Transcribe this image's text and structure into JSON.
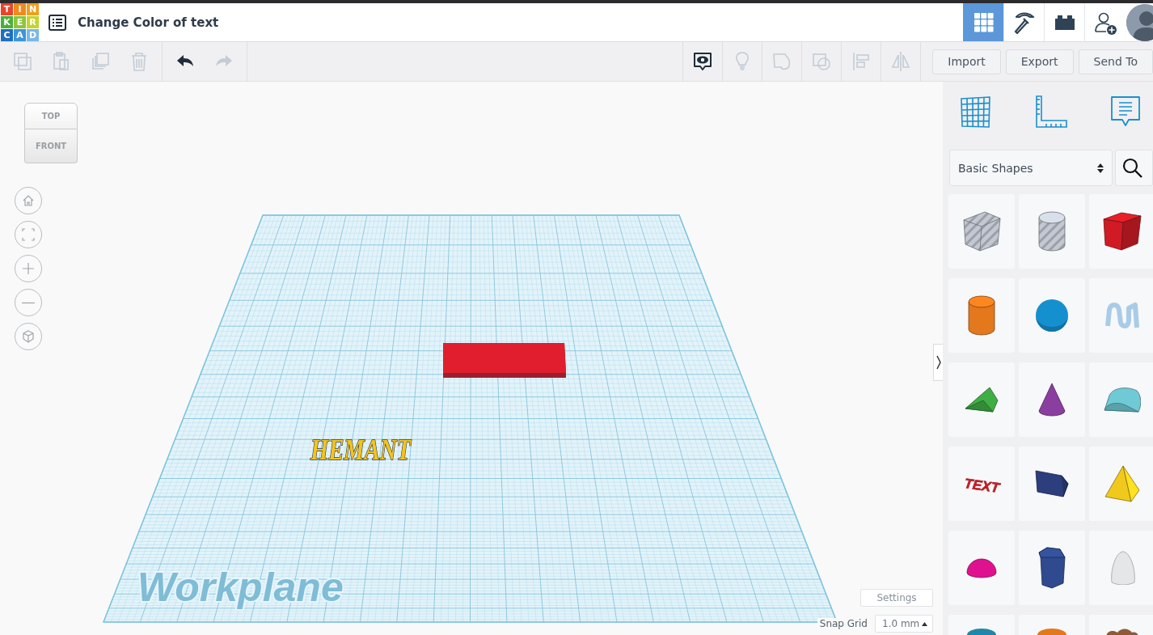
{
  "header": {
    "logo": [
      {
        "letter": "T",
        "color": "#e8442c"
      },
      {
        "letter": "I",
        "color": "#f08a1d"
      },
      {
        "letter": "N",
        "color": "#f0a01d"
      },
      {
        "letter": "K",
        "color": "#4caf3c"
      },
      {
        "letter": "E",
        "color": "#8cc63e"
      },
      {
        "letter": "R",
        "color": "#c5d42c"
      },
      {
        "letter": "C",
        "color": "#1f6ebf"
      },
      {
        "letter": "A",
        "color": "#3d95d9"
      },
      {
        "letter": "D",
        "color": "#7ab9e8"
      }
    ],
    "title": "Change Color of text",
    "nav": [
      {
        "kind": "grid",
        "selected": true
      },
      {
        "kind": "pickaxe",
        "selected": false
      },
      {
        "kind": "brick",
        "selected": false
      },
      {
        "kind": "add-user",
        "selected": false
      }
    ]
  },
  "toolbar": {
    "edit_tools": [
      {
        "kind": "copy",
        "disabled": true
      },
      {
        "kind": "paste",
        "disabled": true
      },
      {
        "kind": "duplicate",
        "disabled": true
      },
      {
        "kind": "delete",
        "disabled": true
      }
    ],
    "history_tools": [
      {
        "kind": "undo",
        "disabled": false
      },
      {
        "kind": "redo",
        "disabled": true
      }
    ],
    "view_tools": [
      {
        "kind": "notes",
        "disabled": false
      },
      {
        "kind": "bulb",
        "disabled": true
      },
      {
        "kind": "group",
        "disabled": true
      },
      {
        "kind": "ungroup",
        "disabled": true
      },
      {
        "kind": "align",
        "disabled": true
      },
      {
        "kind": "mirror",
        "disabled": true
      }
    ],
    "buttons": [
      "Import",
      "Export",
      "Send To"
    ]
  },
  "view_cube": {
    "top": "TOP",
    "front": "FRONT"
  },
  "view_controls": [
    {
      "kind": "home"
    },
    {
      "kind": "fit"
    },
    {
      "kind": "zoom-in"
    },
    {
      "kind": "zoom-out"
    },
    {
      "kind": "perspective"
    }
  ],
  "scene": {
    "workplane_label": "Workplane",
    "text_object": "HEMANT"
  },
  "snap": {
    "settings": "Settings",
    "label": "Snap Grid",
    "value": "1.0 mm"
  },
  "library": {
    "tools": [
      {
        "kind": "grid"
      },
      {
        "kind": "ruler"
      },
      {
        "kind": "notes"
      }
    ],
    "category": "Basic Shapes",
    "shapes": [
      {
        "kind": "box-hole",
        "color": "#c3c8d2"
      },
      {
        "kind": "cylinder-hole",
        "color": "#c3c8d2"
      },
      {
        "kind": "box",
        "color": "#d01b25"
      },
      {
        "kind": "cylinder",
        "color": "#e3781c"
      },
      {
        "kind": "sphere",
        "color": "#1590cf"
      },
      {
        "kind": "scribble",
        "color": "#a9cce6"
      },
      {
        "kind": "roof",
        "color": "#3fae45"
      },
      {
        "kind": "cone",
        "color": "#8a3fa0"
      },
      {
        "kind": "round-roof",
        "color": "#6fcad6"
      },
      {
        "kind": "text",
        "color": "#cc1c24",
        "label": "TEXT"
      },
      {
        "kind": "slab",
        "color": "#2c3e7e"
      },
      {
        "kind": "pyramid",
        "color": "#f0c91c"
      },
      {
        "kind": "half-sphere",
        "color": "#e0118f"
      },
      {
        "kind": "polygon",
        "color": "#2f4a8e"
      },
      {
        "kind": "paraboloid",
        "color": "#e4e6e8"
      },
      {
        "kind": "torus",
        "color": "#1f88a8"
      },
      {
        "kind": "tube",
        "color": "#e3781c"
      },
      {
        "kind": "blob",
        "color": "#8b5a36"
      }
    ]
  }
}
